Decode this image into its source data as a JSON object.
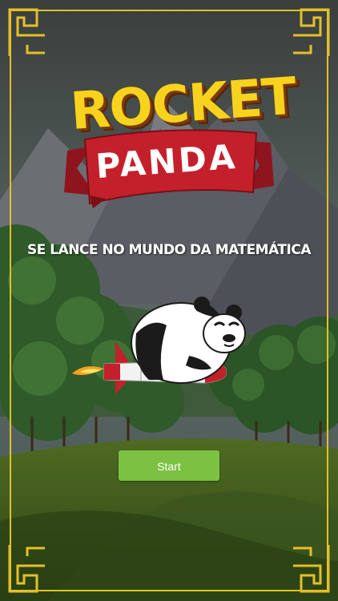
{
  "game": {
    "title_line1": "ROCKET",
    "title_line2": "PANDA",
    "subtitle": "SE LANCE NO MUNDO DA MATEMÁTICA",
    "start_label": "Start"
  },
  "colors": {
    "frame_gold": "#e3c02a",
    "title_yellow": "#f7d31d",
    "banner_red": "#c4202b",
    "start_green": "#7cc142"
  },
  "icons": {
    "corner_ornament": "chinese-fret-corner-icon",
    "mascot": "panda-riding-rocket"
  }
}
